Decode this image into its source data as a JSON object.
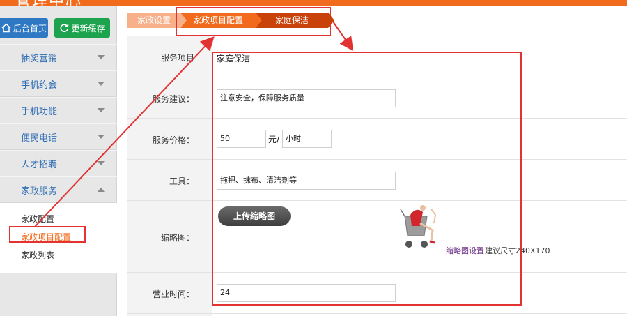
{
  "header": {
    "brand": "管理中心"
  },
  "topbar": {
    "home_label": "后台首页",
    "cache_label": "更新缓存"
  },
  "sidebar": {
    "items": [
      {
        "label": "抽奖营销",
        "expanded": false
      },
      {
        "label": "手机约会",
        "expanded": false
      },
      {
        "label": "手机功能",
        "expanded": false
      },
      {
        "label": "便民电话",
        "expanded": false
      },
      {
        "label": "人才招聘",
        "expanded": false
      },
      {
        "label": "家政服务",
        "expanded": true
      }
    ],
    "sub_items": [
      {
        "label": "家政配置",
        "active": false
      },
      {
        "label": "家政项目配置",
        "active": true
      },
      {
        "label": "家政列表",
        "active": false
      }
    ]
  },
  "breadcrumb": [
    "家政设置",
    "家政项目配置",
    "家庭保洁"
  ],
  "form": {
    "service_item": {
      "label": "服务项目",
      "value": "家庭保洁"
    },
    "service_advice": {
      "label": "服务建议：",
      "value": "注意安全，保障服务质量"
    },
    "price": {
      "label": "服务价格：",
      "value": "50",
      "unit_prefix": "元/",
      "unit": "小时"
    },
    "tools": {
      "label": "工具：",
      "value": "拖把、抹布、清洁剂等"
    },
    "thumbnail": {
      "label": "缩略图：",
      "upload_label": "上传缩略图",
      "settings_link": "缩略图设置",
      "hint": "建议尺寸240X170"
    },
    "hours": {
      "label": "营业时间：",
      "value": "24"
    }
  },
  "colors": {
    "accent": "#f26a1b",
    "annotation": "#e23232",
    "home_btn": "#2f78c4",
    "cache_btn": "#1da34e"
  },
  "icons": {
    "home": "home-icon",
    "refresh": "refresh-icon"
  }
}
